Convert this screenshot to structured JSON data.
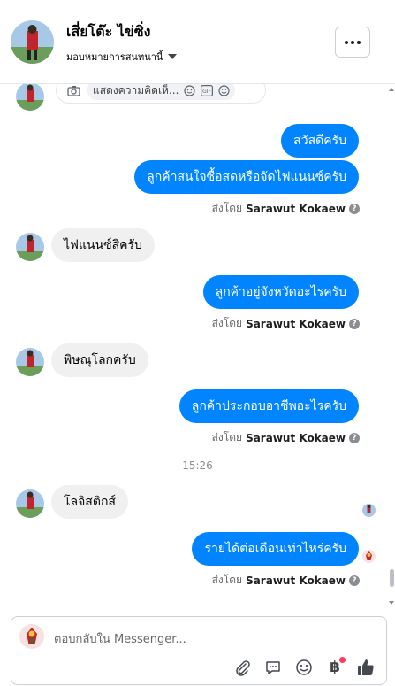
{
  "header": {
    "name": "เสี่ยโต๊ะ ไข่ซิ่ง",
    "assign_label": "มอบหมายการสนทนานี้"
  },
  "comment_box": {
    "placeholder": "แสดงความคิดเห็..."
  },
  "messages": [
    {
      "direction": "out",
      "text": "สวัสดีครับ"
    },
    {
      "direction": "out",
      "text": "ลูกค้าสนใจซื้อสดหรือจัดไฟแนนซ์ครับ"
    },
    {
      "direction": "in",
      "text": "ไฟแนนซ์สิครับ"
    },
    {
      "direction": "out",
      "text": "ลูกค้าอยู่จังหวัดอะไรครับ"
    },
    {
      "direction": "in",
      "text": "พิษณุโลกครับ"
    },
    {
      "direction": "out",
      "text": "ลูกค้าประกอบอาชีพอะไรครับ"
    },
    {
      "direction": "in",
      "text": "โลจิสติกส์"
    },
    {
      "direction": "out",
      "text": "รายได้ต่อเดือนเท่าไหร่ครับ"
    }
  ],
  "sent_by_prefix": "ส่งโดย",
  "sender_name": "Sarawut Kokaew",
  "timestamp": "15:26",
  "composer": {
    "placeholder": "ตอบกลับใน Messenger..."
  },
  "icons": [
    "camera-icon",
    "sticker-icon",
    "gif-icon",
    "emoji-icon",
    "attach-icon",
    "quick-reply-icon",
    "emoji-icon",
    "baht-payment-icon",
    "like-icon"
  ],
  "colors": {
    "outgoing_bubble": "#0084ff",
    "incoming_bubble": "#f0f0f0",
    "accent_like": "#444950",
    "notification_dot": "#fa3e5c"
  }
}
